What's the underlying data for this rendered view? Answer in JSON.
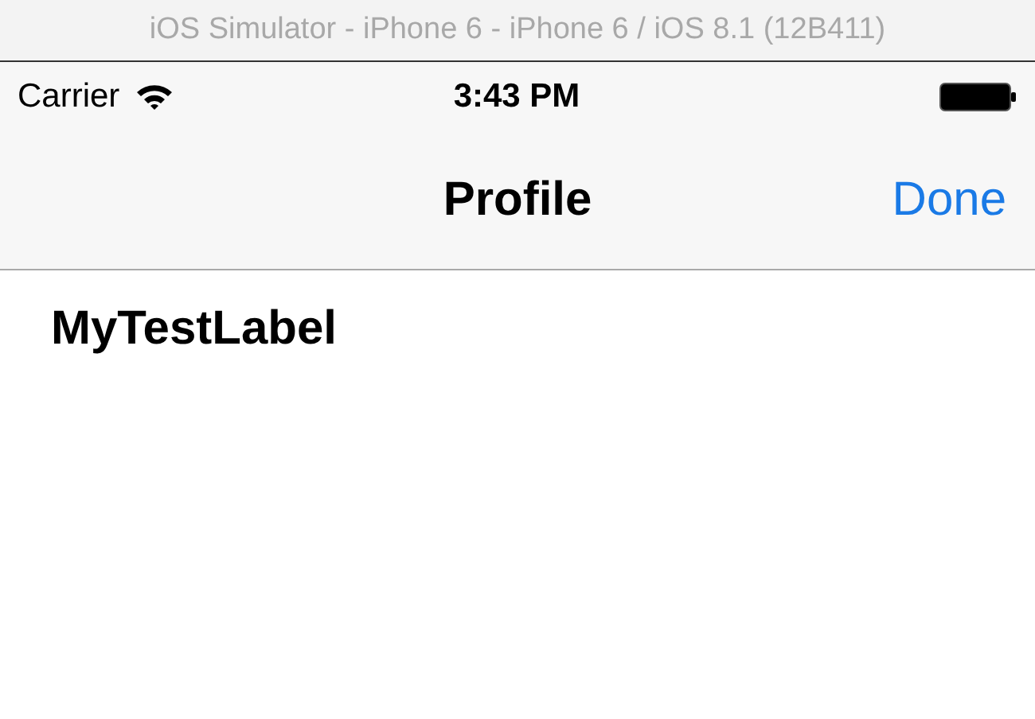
{
  "window": {
    "title": "iOS Simulator - iPhone 6 - iPhone 6 / iOS 8.1 (12B411)"
  },
  "status_bar": {
    "carrier": "Carrier",
    "time": "3:43 PM"
  },
  "nav_bar": {
    "title": "Profile",
    "right_button": "Done"
  },
  "content": {
    "label": "MyTestLabel"
  }
}
